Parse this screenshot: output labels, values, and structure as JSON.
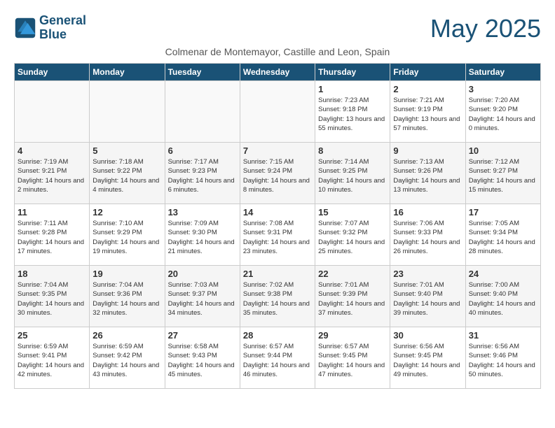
{
  "logo": {
    "line1": "General",
    "line2": "Blue"
  },
  "title": "May 2025",
  "subtitle": "Colmenar de Montemayor, Castille and Leon, Spain",
  "days_of_week": [
    "Sunday",
    "Monday",
    "Tuesday",
    "Wednesday",
    "Thursday",
    "Friday",
    "Saturday"
  ],
  "weeks": [
    [
      {
        "day": "",
        "info": ""
      },
      {
        "day": "",
        "info": ""
      },
      {
        "day": "",
        "info": ""
      },
      {
        "day": "",
        "info": ""
      },
      {
        "day": "1",
        "info": "Sunrise: 7:23 AM\nSunset: 9:18 PM\nDaylight: 13 hours\nand 55 minutes."
      },
      {
        "day": "2",
        "info": "Sunrise: 7:21 AM\nSunset: 9:19 PM\nDaylight: 13 hours\nand 57 minutes."
      },
      {
        "day": "3",
        "info": "Sunrise: 7:20 AM\nSunset: 9:20 PM\nDaylight: 14 hours\nand 0 minutes."
      }
    ],
    [
      {
        "day": "4",
        "info": "Sunrise: 7:19 AM\nSunset: 9:21 PM\nDaylight: 14 hours\nand 2 minutes."
      },
      {
        "day": "5",
        "info": "Sunrise: 7:18 AM\nSunset: 9:22 PM\nDaylight: 14 hours\nand 4 minutes."
      },
      {
        "day": "6",
        "info": "Sunrise: 7:17 AM\nSunset: 9:23 PM\nDaylight: 14 hours\nand 6 minutes."
      },
      {
        "day": "7",
        "info": "Sunrise: 7:15 AM\nSunset: 9:24 PM\nDaylight: 14 hours\nand 8 minutes."
      },
      {
        "day": "8",
        "info": "Sunrise: 7:14 AM\nSunset: 9:25 PM\nDaylight: 14 hours\nand 10 minutes."
      },
      {
        "day": "9",
        "info": "Sunrise: 7:13 AM\nSunset: 9:26 PM\nDaylight: 14 hours\nand 13 minutes."
      },
      {
        "day": "10",
        "info": "Sunrise: 7:12 AM\nSunset: 9:27 PM\nDaylight: 14 hours\nand 15 minutes."
      }
    ],
    [
      {
        "day": "11",
        "info": "Sunrise: 7:11 AM\nSunset: 9:28 PM\nDaylight: 14 hours\nand 17 minutes."
      },
      {
        "day": "12",
        "info": "Sunrise: 7:10 AM\nSunset: 9:29 PM\nDaylight: 14 hours\nand 19 minutes."
      },
      {
        "day": "13",
        "info": "Sunrise: 7:09 AM\nSunset: 9:30 PM\nDaylight: 14 hours\nand 21 minutes."
      },
      {
        "day": "14",
        "info": "Sunrise: 7:08 AM\nSunset: 9:31 PM\nDaylight: 14 hours\nand 23 minutes."
      },
      {
        "day": "15",
        "info": "Sunrise: 7:07 AM\nSunset: 9:32 PM\nDaylight: 14 hours\nand 25 minutes."
      },
      {
        "day": "16",
        "info": "Sunrise: 7:06 AM\nSunset: 9:33 PM\nDaylight: 14 hours\nand 26 minutes."
      },
      {
        "day": "17",
        "info": "Sunrise: 7:05 AM\nSunset: 9:34 PM\nDaylight: 14 hours\nand 28 minutes."
      }
    ],
    [
      {
        "day": "18",
        "info": "Sunrise: 7:04 AM\nSunset: 9:35 PM\nDaylight: 14 hours\nand 30 minutes."
      },
      {
        "day": "19",
        "info": "Sunrise: 7:04 AM\nSunset: 9:36 PM\nDaylight: 14 hours\nand 32 minutes."
      },
      {
        "day": "20",
        "info": "Sunrise: 7:03 AM\nSunset: 9:37 PM\nDaylight: 14 hours\nand 34 minutes."
      },
      {
        "day": "21",
        "info": "Sunrise: 7:02 AM\nSunset: 9:38 PM\nDaylight: 14 hours\nand 35 minutes."
      },
      {
        "day": "22",
        "info": "Sunrise: 7:01 AM\nSunset: 9:39 PM\nDaylight: 14 hours\nand 37 minutes."
      },
      {
        "day": "23",
        "info": "Sunrise: 7:01 AM\nSunset: 9:40 PM\nDaylight: 14 hours\nand 39 minutes."
      },
      {
        "day": "24",
        "info": "Sunrise: 7:00 AM\nSunset: 9:40 PM\nDaylight: 14 hours\nand 40 minutes."
      }
    ],
    [
      {
        "day": "25",
        "info": "Sunrise: 6:59 AM\nSunset: 9:41 PM\nDaylight: 14 hours\nand 42 minutes."
      },
      {
        "day": "26",
        "info": "Sunrise: 6:59 AM\nSunset: 9:42 PM\nDaylight: 14 hours\nand 43 minutes."
      },
      {
        "day": "27",
        "info": "Sunrise: 6:58 AM\nSunset: 9:43 PM\nDaylight: 14 hours\nand 45 minutes."
      },
      {
        "day": "28",
        "info": "Sunrise: 6:57 AM\nSunset: 9:44 PM\nDaylight: 14 hours\nand 46 minutes."
      },
      {
        "day": "29",
        "info": "Sunrise: 6:57 AM\nSunset: 9:45 PM\nDaylight: 14 hours\nand 47 minutes."
      },
      {
        "day": "30",
        "info": "Sunrise: 6:56 AM\nSunset: 9:45 PM\nDaylight: 14 hours\nand 49 minutes."
      },
      {
        "day": "31",
        "info": "Sunrise: 6:56 AM\nSunset: 9:46 PM\nDaylight: 14 hours\nand 50 minutes."
      }
    ]
  ]
}
